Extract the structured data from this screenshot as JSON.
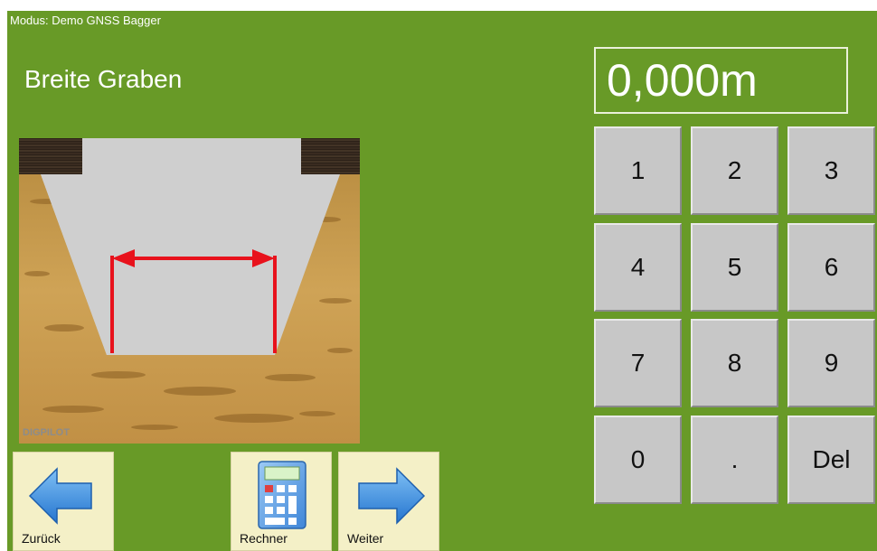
{
  "header": {
    "mode": "Modus: Demo GNSS Bagger"
  },
  "page": {
    "title": "Breite Graben"
  },
  "display": {
    "value": "0,000m"
  },
  "illustration": {
    "watermark": "DIGPILOT",
    "subject": "trench cross-section with width measurement arrow"
  },
  "keypad": {
    "keys": [
      "1",
      "2",
      "3",
      "4",
      "5",
      "6",
      "7",
      "8",
      "9",
      "0",
      ".",
      "Del"
    ]
  },
  "toolbar": {
    "back_label": "Zurück",
    "back_icon": "arrow-left-icon",
    "calculator_label": "Rechner",
    "calculator_icon": "calculator-icon",
    "next_label": "Weiter",
    "next_icon": "arrow-right-icon"
  },
  "colors": {
    "background": "#689a27",
    "key": "#c7c7c7",
    "nav_button": "#f4f0c7",
    "arrow_blue": "#3b8ee0",
    "measure_red": "#e8121c",
    "trench": "#cfcfcf",
    "soil": "#c89a4a"
  }
}
